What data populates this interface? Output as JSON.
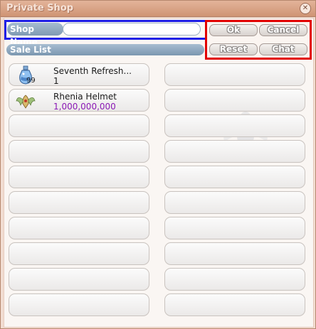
{
  "window": {
    "title": "Private Shop",
    "close_glyph": "✕"
  },
  "shop_name": {
    "label": "Shop Name",
    "value": "",
    "placeholder": ""
  },
  "sale_list": {
    "label": "Sale List"
  },
  "buttons": {
    "ok": "Ok",
    "cancel": "Cancel",
    "reset": "Reset",
    "chat": "Chat"
  },
  "items": [
    {
      "name": "Seventh Refresh...",
      "value": "1",
      "quantity_badge": "99",
      "icon": "potion-bottle-icon",
      "value_kind": "quantity"
    },
    {
      "name": "Rhenia Helmet",
      "value": "1,000,000,000",
      "icon": "winged-helmet-icon",
      "value_kind": "price"
    }
  ],
  "colors": {
    "title_bar": "#d79c7d",
    "shop_name_border": "#1f1fe6",
    "buttons_border": "#e20000",
    "price_text": "#8a18b5",
    "label_pill": "#8aa4bb"
  }
}
